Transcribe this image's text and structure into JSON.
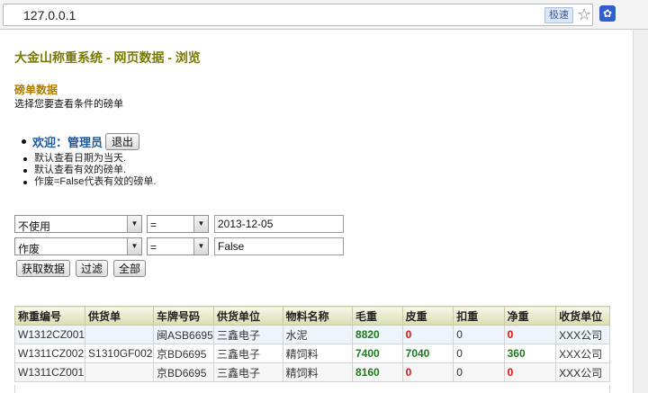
{
  "browser": {
    "url": "127.0.0.1",
    "fast_mode_label": "极速"
  },
  "page": {
    "site_title": "大金山称重系统 - 网页数据 - 浏览",
    "section_title": "磅单数据",
    "section_desc": "选择您要查看条件的磅单",
    "welcome": "欢迎：管理员",
    "logout_label": "退出",
    "notes": [
      "默认查看日期为当天.",
      "默认查看有效的磅单.",
      "作废=False代表有效的磅单."
    ]
  },
  "filters": [
    {
      "field": "不使用",
      "operator": "=",
      "value": "2013-12-05"
    },
    {
      "field": "作废",
      "operator": "=",
      "value": "False"
    }
  ],
  "buttons": {
    "fetch": "获取数据",
    "filter": "过滤",
    "all": "全部"
  },
  "table": {
    "headers": [
      "称重编号",
      "供货单",
      "车牌号码",
      "供货单位",
      "物料名称",
      "毛重",
      "皮重",
      "扣重",
      "净重",
      "收货单位"
    ],
    "rows": [
      [
        "W1312CZ001",
        "",
        "闽ASB6695",
        "三鑫电子",
        "水泥",
        "8820",
        "0",
        "0",
        "0",
        "XXX公司"
      ],
      [
        "W1311CZ002",
        "S1310GF002",
        "京BD6695",
        "三鑫电子",
        "精饲料",
        "7400",
        "7040",
        "0",
        "360",
        "XXX公司"
      ],
      [
        "W1311CZ001",
        "",
        "京BD6695",
        "三鑫电子",
        "精饲料",
        "8160",
        "0",
        "0",
        "0",
        "XXX公司"
      ]
    ]
  },
  "colors": {
    "accent_title": "#7a7a00",
    "welcome_blue": "#1b58a5",
    "value_green": "#1f7a1f",
    "value_red": "#dd1111"
  }
}
